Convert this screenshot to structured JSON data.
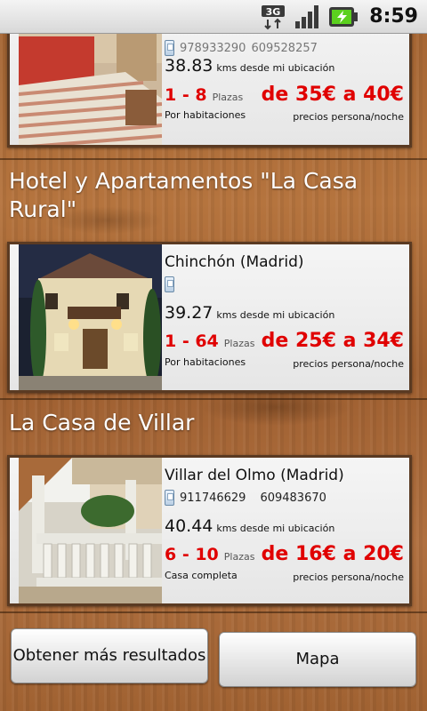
{
  "status_bar": {
    "network": "3G",
    "time": "8:59"
  },
  "listings": [
    {
      "title": "",
      "phones": [
        "978933290",
        "609528257"
      ],
      "distance": "38.83",
      "distance_text": "kms desde mi ubicación",
      "plazas": "1 - 8",
      "plazas_label": "Plazas",
      "rental_type": "Por habitaciones",
      "price": "de 35€ a 40€",
      "price_note": "precios persona/noche"
    },
    {
      "title": "Hotel y Apartamentos \"La Casa Rural\"",
      "location": "Chinchón (Madrid)",
      "phones": [],
      "distance": "39.27",
      "distance_text": "kms desde mi ubicación",
      "plazas": "1 - 64",
      "plazas_label": "Plazas",
      "rental_type": "Por habitaciones",
      "price": "de 25€ a 34€",
      "price_note": "precios persona/noche"
    },
    {
      "title": "La Casa de Villar",
      "location": "Villar del Olmo (Madrid)",
      "phones": [
        "911746629",
        "609483670"
      ],
      "distance": "40.44",
      "distance_text": "kms desde mi ubicación",
      "plazas": "6 - 10",
      "plazas_label": "Plazas",
      "rental_type": "Casa completa",
      "price": "de 16€ a 20€",
      "price_note": "precios persona/noche"
    }
  ],
  "buttons": {
    "more": "Obtener más resultados",
    "map": "Mapa"
  }
}
